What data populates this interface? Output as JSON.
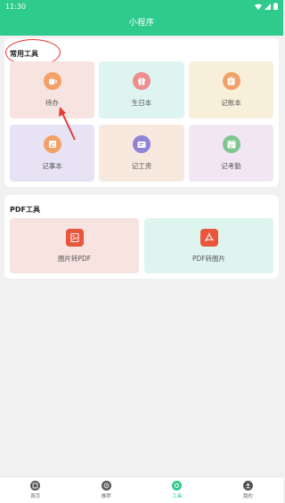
{
  "status": {
    "time": "11:30"
  },
  "header": {
    "title": "小程序"
  },
  "common_tools": {
    "title": "常用工具",
    "items": [
      {
        "label": "待办",
        "icon": "cup-icon",
        "bg": "#f7e3df",
        "icon_color": "#f2a268"
      },
      {
        "label": "生日本",
        "icon": "gift-icon",
        "bg": "#def4f1",
        "icon_color": "#ee8d8d"
      },
      {
        "label": "记账本",
        "icon": "clipboard-icon",
        "bg": "#f8efda",
        "icon_color": "#f2a268"
      },
      {
        "label": "记事本",
        "icon": "notebook-icon",
        "bg": "#e8e3f4",
        "icon_color": "#f2a268"
      },
      {
        "label": "记工资",
        "icon": "wallet-icon",
        "bg": "#f8e9df",
        "icon_color": "#8f84d6"
      },
      {
        "label": "记考勤",
        "icon": "calendar-icon",
        "bg": "#f2e6f2",
        "icon_color": "#7fc78e"
      }
    ]
  },
  "pdf_tools": {
    "title": "PDF工具",
    "items": [
      {
        "label": "图片转PDF",
        "icon": "image-to-pdf-icon",
        "bg": "#f7e3df",
        "icon_color": "#e8573c"
      },
      {
        "label": "PDF转图片",
        "icon": "pdf-to-image-icon",
        "bg": "#def4ef",
        "icon_color": "#e8573c"
      }
    ]
  },
  "tabs": [
    {
      "label": "首页",
      "icon": "home-icon",
      "active": false
    },
    {
      "label": "推荐",
      "icon": "compass-icon",
      "active": false
    },
    {
      "label": "工具",
      "icon": "tools-icon",
      "active": true
    },
    {
      "label": "我的",
      "icon": "profile-icon",
      "active": false
    }
  ],
  "colors": {
    "brand": "#2fcb8c",
    "annotation": "#e53935"
  }
}
